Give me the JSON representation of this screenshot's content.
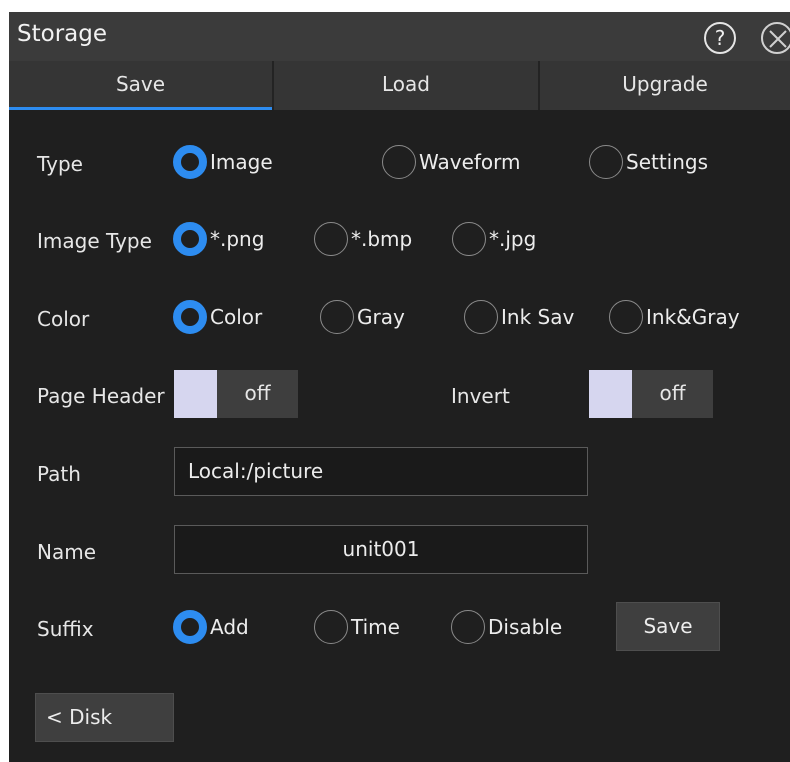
{
  "window": {
    "title": "Storage",
    "help_glyph": "?",
    "close_icon": "close-icon"
  },
  "tabs": [
    {
      "label": "Save",
      "active": true
    },
    {
      "label": "Load",
      "active": false
    },
    {
      "label": "Upgrade",
      "active": false
    }
  ],
  "form": {
    "type": {
      "label": "Type",
      "options": [
        "Image",
        "Waveform",
        "Settings"
      ],
      "selected": "Image"
    },
    "image_type": {
      "label": "Image Type",
      "options": [
        "*.png",
        "*.bmp",
        "*.jpg"
      ],
      "selected": "*.png"
    },
    "color": {
      "label": "Color",
      "options": [
        "Color",
        "Gray",
        "Ink Sav",
        "Ink&Gray"
      ],
      "selected": "Color"
    },
    "page_header": {
      "label": "Page Header",
      "state": "off"
    },
    "invert": {
      "label": "Invert",
      "state": "off"
    },
    "path": {
      "label": "Path",
      "value": "Local:/picture"
    },
    "name": {
      "label": "Name",
      "value": "unit001"
    },
    "suffix": {
      "label": "Suffix",
      "options": [
        "Add",
        "Time",
        "Disable"
      ],
      "selected": "Add"
    },
    "save_button": "Save",
    "disk_button": "< Disk"
  },
  "colors": {
    "accent": "#2d8cf0",
    "background": "#1f1f1f",
    "titlebar": "#3b3b3b",
    "toggle_knob": "#d6d6ef"
  }
}
